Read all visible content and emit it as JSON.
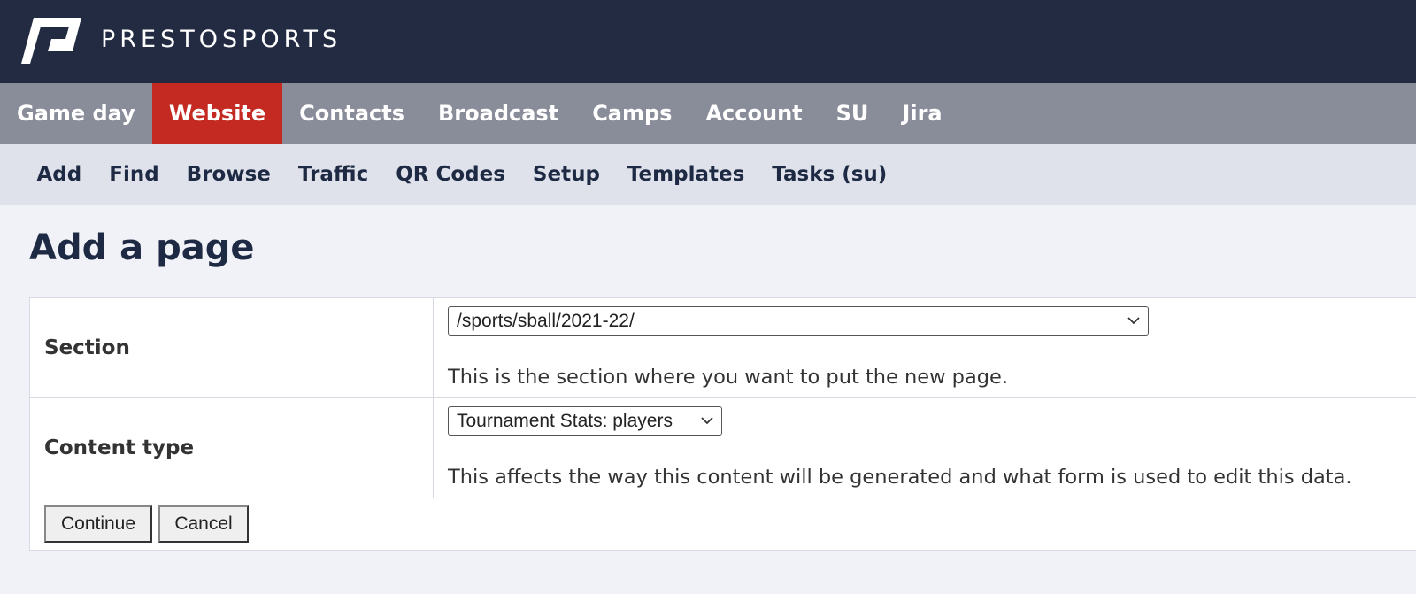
{
  "brand": {
    "name": "PRESTOSPORTS",
    "logo_icon": "prestosports-logo-icon"
  },
  "colors": {
    "topbar": "#222b42",
    "mainnav": "#898d99",
    "active_tab": "#c42a22",
    "subnav": "#dfe2eb",
    "page_bg": "#f0f2f7"
  },
  "main_nav": {
    "items": [
      {
        "label": "Game day",
        "active": false
      },
      {
        "label": "Website",
        "active": true
      },
      {
        "label": "Contacts",
        "active": false
      },
      {
        "label": "Broadcast",
        "active": false
      },
      {
        "label": "Camps",
        "active": false
      },
      {
        "label": "Account",
        "active": false
      },
      {
        "label": "SU",
        "active": false
      },
      {
        "label": "Jira",
        "active": false
      }
    ]
  },
  "sub_nav": {
    "items": [
      {
        "label": "Add"
      },
      {
        "label": "Find"
      },
      {
        "label": "Browse"
      },
      {
        "label": "Traffic"
      },
      {
        "label": "QR Codes"
      },
      {
        "label": "Setup"
      },
      {
        "label": "Templates"
      },
      {
        "label": "Tasks (su)"
      }
    ]
  },
  "page": {
    "title": "Add a page"
  },
  "form": {
    "section": {
      "label": "Section",
      "selected": "/sports/sball/2021-22/",
      "hint": "This is the section where you want to put the new page.",
      "icon": "chevron-down-icon"
    },
    "content_type": {
      "label": "Content type",
      "selected": "Tournament Stats: players",
      "hint": "This affects the way this content will be generated and what form is used to edit this data.",
      "icon": "chevron-down-icon"
    },
    "buttons": {
      "continue": "Continue",
      "cancel": "Cancel"
    }
  }
}
